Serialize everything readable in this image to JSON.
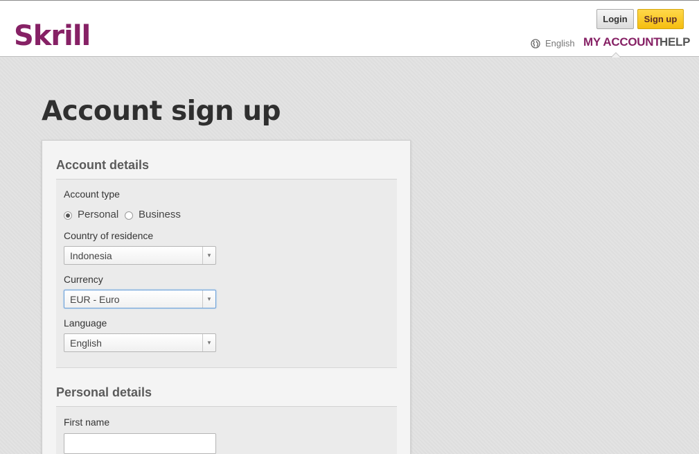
{
  "header": {
    "logo": "Skrill",
    "login_label": "Login",
    "signup_label": "Sign up",
    "language": "English",
    "nav": {
      "my_account": "MY ACCOUNT",
      "help": "HELP"
    }
  },
  "page_title": "Account sign up",
  "account_details": {
    "title": "Account details",
    "account_type_label": "Account type",
    "options": {
      "personal": "Personal",
      "business": "Business"
    },
    "selected_type": "Personal",
    "country_label": "Country of residence",
    "country_value": "Indonesia",
    "currency_label": "Currency",
    "currency_value": "EUR - Euro",
    "language_label": "Language",
    "language_value": "English"
  },
  "personal_details": {
    "title": "Personal details",
    "first_name_label": "First name",
    "first_name_value": ""
  },
  "colors": {
    "brand": "#862165",
    "signup_button": "#f5be10",
    "background": "#e2e2e2"
  },
  "icons": [
    "globe-icon",
    "dropdown-arrow-icon"
  ]
}
